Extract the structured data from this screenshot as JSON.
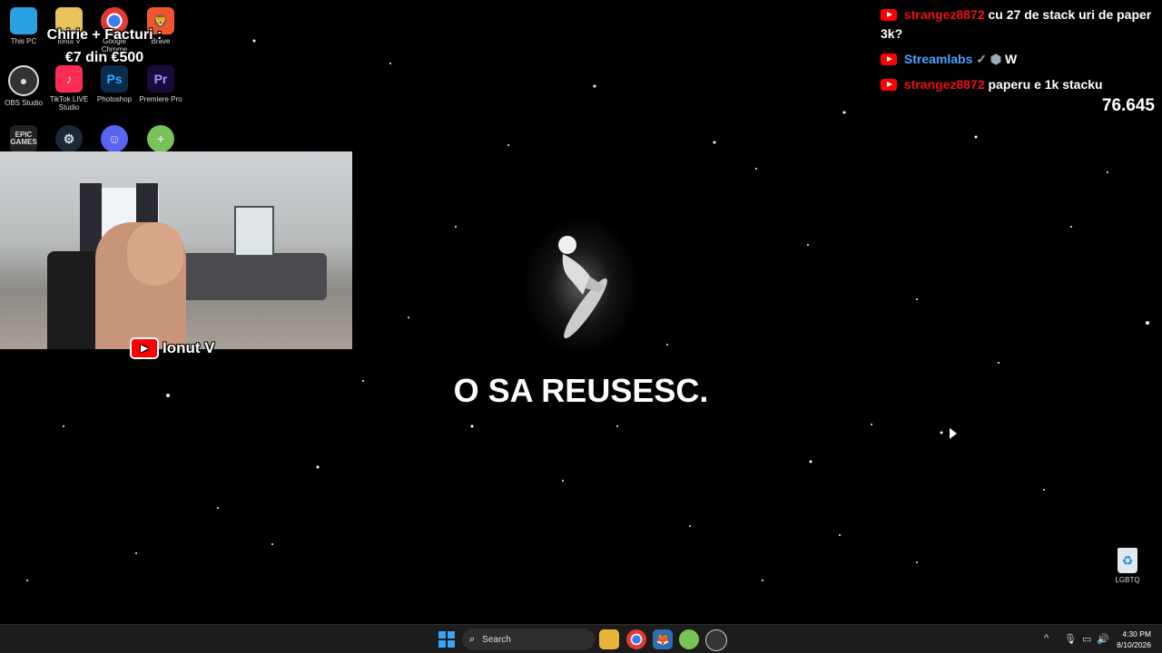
{
  "desktop": {
    "icons": [
      {
        "label": "This PC",
        "icon": "monitor-icon",
        "color": "#2aa0e0"
      },
      {
        "label": "Ionut V",
        "icon": "folder-icon",
        "color": "#e8c25a"
      },
      {
        "label": "Google Chrome",
        "icon": "chrome-icon",
        "color": "#e53935"
      },
      {
        "label": "Brave",
        "icon": "brave-icon",
        "color": "#f2542d"
      },
      {
        "label": "OBS Studio",
        "icon": "obs-icon",
        "color": "#333333"
      },
      {
        "label": "TikTok LIVE Studio",
        "icon": "tiktok-icon",
        "color": "#fe2c55"
      },
      {
        "label": "Photoshop",
        "icon": "photoshop-icon",
        "color": "#0a2b4c"
      },
      {
        "label": "Premiere Pro",
        "icon": "premiere-icon",
        "color": "#1a0a3c"
      },
      {
        "label": "EPIC GAMES",
        "icon": "epic-games-icon",
        "color": "#222222"
      },
      {
        "label": "",
        "icon": "steam-icon",
        "color": "#1b2838"
      },
      {
        "label": "",
        "icon": "discord-icon",
        "color": "#5865f2"
      },
      {
        "label": "",
        "icon": "android-icon",
        "color": "#78c257"
      }
    ],
    "recycle_bin_label": "LGBTQ"
  },
  "overlay": {
    "goal_title": "Chirie + Facturi :",
    "goal_progress": "€7 din €500",
    "webcam_name": "Ionut V",
    "motto": "O SA REUSESC.",
    "counter": "76.645"
  },
  "chat": [
    {
      "user": "strangez8872",
      "user_color": "red",
      "text": "cu 27 de stack uri de paper 3k?"
    },
    {
      "user": "Streamlabs",
      "user_color": "blue",
      "text": "W",
      "badges": "✓ ⬢"
    },
    {
      "user": "strangez8872",
      "user_color": "red",
      "text": "paperu e 1k stacku"
    }
  ],
  "taskbar": {
    "search_placeholder": "Search",
    "apps": [
      "file-explorer-icon",
      "chrome-icon",
      "brave-icon",
      "android-icon",
      "obs-icon"
    ],
    "time": "4:30 PM",
    "date": "8/10/2026"
  },
  "colors": {
    "accent_red": "#ff0000",
    "start_blue": "#3ea2f5",
    "taskbar_bg": "#1c1c1c"
  }
}
